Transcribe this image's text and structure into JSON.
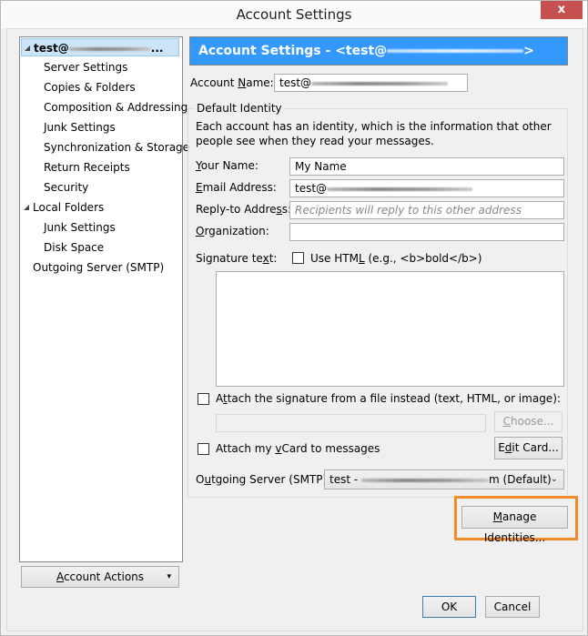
{
  "window": {
    "title": "Account Settings",
    "close_glyph": "x"
  },
  "tree": {
    "items": [
      {
        "label": "test@",
        "redacted": true,
        "suffix": "...",
        "level": 0,
        "expanded": true,
        "selected": true
      },
      {
        "label": "Server Settings",
        "level": 1
      },
      {
        "label": "Copies & Folders",
        "level": 1
      },
      {
        "label": "Composition & Addressing",
        "level": 1
      },
      {
        "label": "Junk Settings",
        "level": 1
      },
      {
        "label": "Synchronization & Storage",
        "level": 1
      },
      {
        "label": "Return Receipts",
        "level": 1
      },
      {
        "label": "Security",
        "level": 1
      },
      {
        "label": "Local Folders",
        "level": 0,
        "expanded": true
      },
      {
        "label": "Junk Settings",
        "level": 1
      },
      {
        "label": "Disk Space",
        "level": 1
      },
      {
        "label": "Outgoing Server (SMTP)",
        "level": 0
      }
    ],
    "account_actions_label": "Account Actions",
    "account_actions_accesskey": "A",
    "dropdown_glyph": "▾"
  },
  "header": {
    "prefix": "Account Settings - <test@",
    "suffix": ">"
  },
  "account_name": {
    "label_pre": "Account ",
    "label_key": "N",
    "label_post": "ame:",
    "value": "test@"
  },
  "identity": {
    "legend": "Default Identity",
    "description": "Each account has an identity, which is the information that other people see when they read your messages.",
    "your_name": {
      "label_key": "Y",
      "label_post": "our Name:",
      "value": "My Name"
    },
    "email": {
      "label_key": "E",
      "label_post": "mail Address:",
      "value": "test@"
    },
    "reply_to": {
      "label_pre": "Reply-to Addre",
      "label_key": "s",
      "label_post": "s:",
      "placeholder": "Recipients will reply to this other address",
      "value": ""
    },
    "organization": {
      "label_key": "O",
      "label_post": "rganization:",
      "value": ""
    },
    "signature": {
      "label_pre": "Signature te",
      "label_key": "x",
      "label_post": "t:",
      "use_html_pre": "Use HTM",
      "use_html_key": "L",
      "use_html_post": " (e.g., <b>bold</b>)",
      "use_html_checked": false,
      "text": ""
    },
    "attach_file": {
      "label_pre": "A",
      "label_key": "t",
      "label_post": "tach the signature from a file instead (text, HTML, or image):",
      "checked": false,
      "path": ""
    },
    "choose_label_key": "C",
    "choose_label_post": "hoose...",
    "attach_vcard": {
      "label_pre": "Attach my ",
      "label_key": "v",
      "label_post": "Card to messages",
      "checked": false
    },
    "edit_card_pre": "E",
    "edit_card_key": "d",
    "edit_card_post": "it Card...",
    "smtp": {
      "label_pre": "O",
      "label_key": "u",
      "label_post": "tgoing Server (SMTP):",
      "value_pre": "test - ",
      "value_post": "m (Default)",
      "arrow": "⌄"
    }
  },
  "manage_identities": {
    "label_key": "M",
    "label_post": "anage Identities...",
    "highlight_color": "#f28c28"
  },
  "footer": {
    "ok_label": "OK",
    "cancel_label": "Cancel"
  },
  "colors": {
    "header_bg": "#3399ff",
    "selection_bg": "#cce4f7",
    "close_bg": "#c75050"
  }
}
